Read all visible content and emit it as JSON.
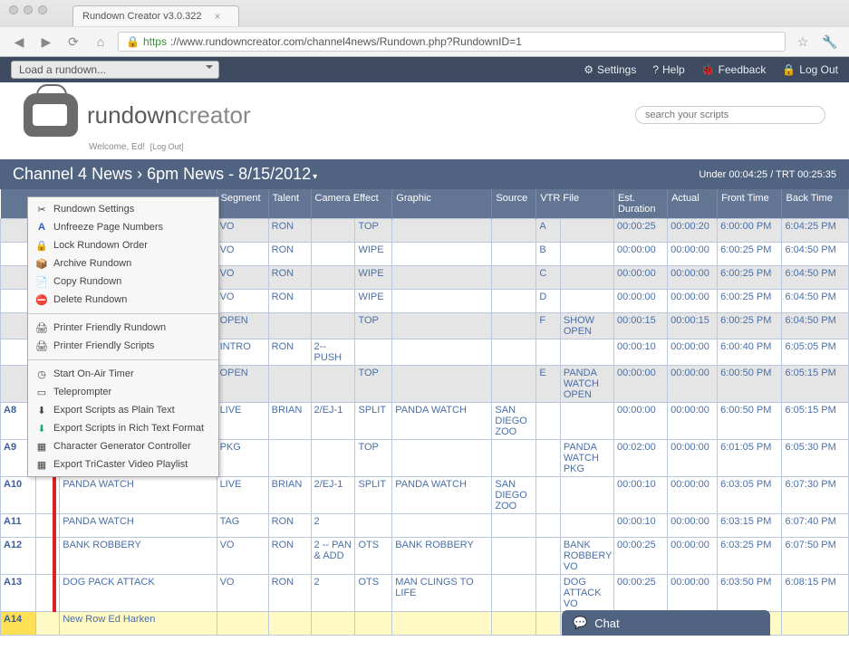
{
  "browser": {
    "tab_title": "Rundown Creator v3.0.322",
    "url_scheme": "https",
    "url_rest": "://www.rundowncreator.com/channel4news/Rundown.php?RundownID=1"
  },
  "toolbar": {
    "load_label": "Load a rundown...",
    "settings": "Settings",
    "help": "Help",
    "feedback": "Feedback",
    "logout": "Log Out"
  },
  "logo": {
    "word1": "rundown",
    "word2": "creator"
  },
  "welcome": {
    "text": "Welcome, Ed!",
    "logout": "[Log Out]"
  },
  "search": {
    "placeholder": "search your scripts"
  },
  "header": {
    "title": "Channel 4 News › 6pm News - 8/15/2012",
    "under": "Under 00:04:25",
    "trt": "TRT 00:25:35"
  },
  "columns": {
    "page": "",
    "slug": "",
    "segment": "Segment",
    "talent": "Talent",
    "camera": "Camera Effect",
    "graphic": "Graphic",
    "source": "Source",
    "vtr": "VTR File",
    "est": "Est. Duration",
    "actual": "Actual",
    "front": "Front Time",
    "back": "Back Time"
  },
  "menu": {
    "settings": "Rundown Settings",
    "unfreeze": "Unfreeze Page Numbers",
    "lock": "Lock Rundown Order",
    "archive": "Archive Rundown",
    "copy": "Copy Rundown",
    "delete": "Delete Rundown",
    "pf_rundown": "Printer Friendly Rundown",
    "pf_scripts": "Printer Friendly Scripts",
    "timer": "Start On-Air Timer",
    "prompter": "Teleprompter",
    "export_plain": "Export Scripts as Plain Text",
    "export_rtf": "Export Scripts in Rich Text Format",
    "cg": "Character Generator Controller",
    "tricaster": "Export TriCaster Video Playlist"
  },
  "rows": [
    {
      "pg": "",
      "slug": "",
      "seg": "VO",
      "tal": "RON",
      "cam": "",
      "gfx": "TOP",
      "src": "",
      "vtr": "A",
      "file": "",
      "est": "00:00:25",
      "act": "00:00:20",
      "ft": "6:00:00 PM",
      "bt": "6:04:25 PM",
      "shade": true
    },
    {
      "pg": "",
      "slug": "",
      "seg": "VO",
      "tal": "RON",
      "cam": "",
      "gfx": "WIPE",
      "src": "",
      "vtr": "B",
      "file": "",
      "est": "00:00:00",
      "act": "00:00:00",
      "ft": "6:00:25 PM",
      "bt": "6:04:50 PM",
      "shade": false
    },
    {
      "pg": "",
      "slug": "",
      "seg": "VO",
      "tal": "RON",
      "cam": "",
      "gfx": "WIPE",
      "src": "",
      "vtr": "C",
      "file": "",
      "est": "00:00:00",
      "act": "00:00:00",
      "ft": "6:00:25 PM",
      "bt": "6:04:50 PM",
      "shade": true
    },
    {
      "pg": "",
      "slug": "",
      "seg": "VO",
      "tal": "RON",
      "cam": "",
      "gfx": "WIPE",
      "src": "",
      "vtr": "D",
      "file": "",
      "est": "00:00:00",
      "act": "00:00:00",
      "ft": "6:00:25 PM",
      "bt": "6:04:50 PM",
      "shade": false
    },
    {
      "pg": "",
      "slug": "",
      "seg": "OPEN",
      "tal": "",
      "cam": "",
      "gfx": "TOP",
      "src": "",
      "vtr": "F",
      "file": "SHOW OPEN",
      "est": "00:00:15",
      "act": "00:00:15",
      "ft": "6:00:25 PM",
      "bt": "6:04:50 PM",
      "shade": true
    },
    {
      "pg": "",
      "slug": "",
      "seg": "INTRO",
      "tal": "RON",
      "cam": "2--PUSH",
      "gfx": "",
      "src": "",
      "vtr": "",
      "file": "",
      "est": "00:00:10",
      "act": "00:00:00",
      "ft": "6:00:40 PM",
      "bt": "6:05:05 PM",
      "shade": false
    },
    {
      "pg": "",
      "slug": "",
      "seg": "OPEN",
      "tal": "",
      "cam": "",
      "gfx": "TOP",
      "src": "",
      "vtr": "E",
      "file": "PANDA WATCH OPEN",
      "est": "00:00:00",
      "act": "00:00:00",
      "ft": "6:00:50 PM",
      "bt": "6:05:15 PM",
      "shade": true
    },
    {
      "pg": "A8",
      "slug": "PANDA WATCH",
      "seg": "LIVE",
      "tal": "BRIAN",
      "cam": "2/EJ-1",
      "gfx": "SPLIT",
      "gfx2": "PANDA WATCH",
      "src": "SAN DIEGO ZOO",
      "vtr": "",
      "file": "",
      "est": "00:00:00",
      "act": "00:00:00",
      "ft": "6:00:50 PM",
      "bt": "6:05:15 PM",
      "shade": false
    },
    {
      "pg": "A9",
      "slug": "PANDA WATCH",
      "seg": "PKG",
      "tal": "",
      "cam": "",
      "gfx": "TOP",
      "src": "",
      "vtr": "",
      "file": "PANDA WATCH PKG",
      "est": "00:02:00",
      "act": "00:00:00",
      "ft": "6:01:05 PM",
      "bt": "6:05:30 PM",
      "shade": false
    },
    {
      "pg": "A10",
      "slug": "PANDA WATCH",
      "seg": "LIVE",
      "tal": "BRIAN",
      "cam": "2/EJ-1",
      "gfx": "SPLIT",
      "gfx2": "PANDA WATCH",
      "src": "SAN DIEGO ZOO",
      "vtr": "",
      "file": "",
      "est": "00:00:10",
      "act": "00:00:00",
      "ft": "6:03:05 PM",
      "bt": "6:07:30 PM",
      "shade": false
    },
    {
      "pg": "A11",
      "slug": "PANDA WATCH",
      "seg": "TAG",
      "tal": "RON",
      "cam": "2",
      "gfx": "",
      "src": "",
      "vtr": "",
      "file": "",
      "est": "00:00:10",
      "act": "00:00:00",
      "ft": "6:03:15 PM",
      "bt": "6:07:40 PM",
      "shade": false
    },
    {
      "pg": "A12",
      "slug": "BANK ROBBERY",
      "seg": "VO",
      "tal": "RON",
      "cam": "2 -- PAN & ADD",
      "gfx": "OTS",
      "gfx2": "BANK ROBBERY",
      "src": "",
      "vtr": "",
      "file": "BANK ROBBERY VO",
      "est": "00:00:25",
      "act": "00:00:00",
      "ft": "6:03:25 PM",
      "bt": "6:07:50 PM",
      "shade": false
    },
    {
      "pg": "A13",
      "slug": "DOG PACK ATTACK",
      "seg": "VO",
      "tal": "RON",
      "cam": "2",
      "gfx": "OTS",
      "gfx2": "MAN CLINGS TO LIFE",
      "src": "",
      "vtr": "",
      "file": "DOG ATTACK VO",
      "est": "00:00:25",
      "act": "00:00:00",
      "ft": "6:03:50 PM",
      "bt": "6:08:15 PM",
      "shade": false
    },
    {
      "pg": "A14",
      "slug": "New Row Ed Harken",
      "seg": "",
      "tal": "",
      "cam": "",
      "gfx": "",
      "src": "",
      "vtr": "",
      "file": "",
      "est": "",
      "act": "",
      "ft": "",
      "bt": "",
      "shade": false,
      "yellow": true
    }
  ],
  "chat": {
    "label": "Chat"
  }
}
